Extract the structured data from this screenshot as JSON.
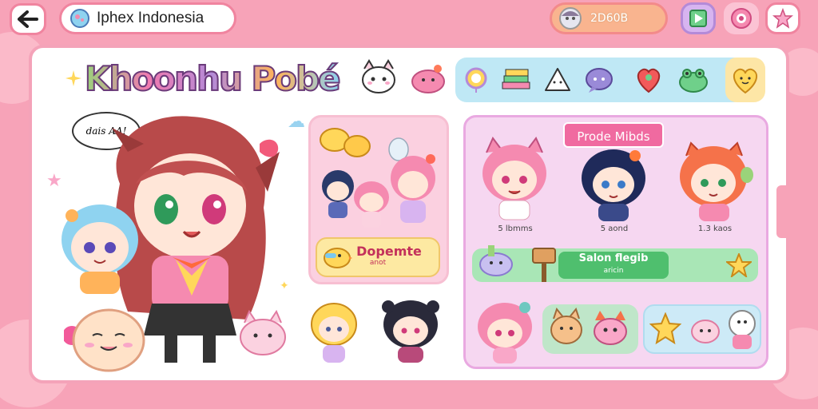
{
  "header": {
    "title": "Iphex Indonesia",
    "coins": "2D60B"
  },
  "logo_text": "Khoonhu Pobé",
  "speech_bubble": "dais AA!",
  "categories": [
    "balloon-icon",
    "books-icon",
    "onigiri-icon",
    "chat-icon",
    "heart-bubble-icon",
    "frog-icon"
  ],
  "middle_card": {
    "label": "Dopemte",
    "sub": "anot"
  },
  "right_card": {
    "title": "Prode Mibds",
    "characters": [
      {
        "name": "pink-hair-cat-girl",
        "label": "5 lbmms"
      },
      {
        "name": "navy-hair-girl",
        "label": "5 aond"
      },
      {
        "name": "orange-hair-cat-girl",
        "label": "1.3 kaos"
      }
    ],
    "salon": {
      "label": "Salon flegib",
      "sub": "aricin"
    }
  },
  "colors": {
    "background": "#f7a3b8",
    "accent_pink": "#f06aa0",
    "accent_green": "#4fbf6e"
  }
}
